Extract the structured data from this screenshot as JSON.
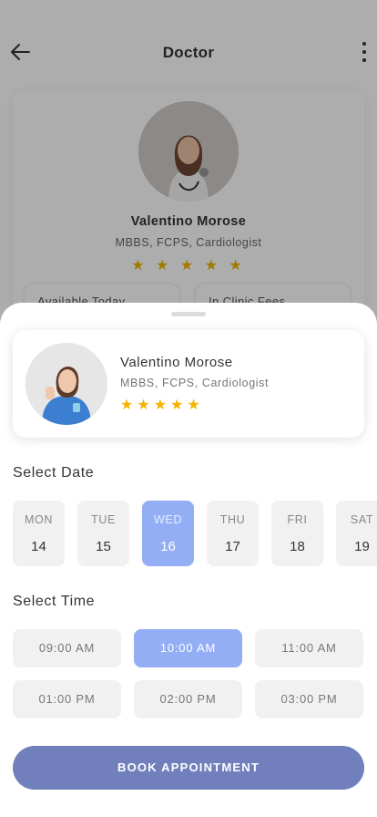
{
  "header": {
    "title": "Doctor"
  },
  "doctor": {
    "name": "Valentino Morose",
    "credentials": "MBBS, FCPS, Cardiologist",
    "rating": 5,
    "rating_text": "★ ★ ★ ★ ★"
  },
  "info": {
    "available_label": "Available Today",
    "fees_label": "In Clinic Fees"
  },
  "booking": {
    "select_date_label": "Select Date",
    "select_time_label": "Select Time",
    "dates": [
      {
        "day": "MON",
        "num": "14"
      },
      {
        "day": "TUE",
        "num": "15"
      },
      {
        "day": "WED",
        "num": "16"
      },
      {
        "day": "THU",
        "num": "17"
      },
      {
        "day": "FRI",
        "num": "18"
      },
      {
        "day": "SAT",
        "num": "19"
      }
    ],
    "selected_date": "WED 16",
    "times": [
      "09:00 AM",
      "10:00 AM",
      "11:00 AM",
      "01:00 PM",
      "02:00 PM",
      "03:00 PM"
    ],
    "selected_time": "10:00 AM",
    "book_label": "BOOK APPOINTMENT"
  },
  "colors": {
    "accent": "#93aef5",
    "button": "#7180bd",
    "star": "#f5b301"
  }
}
